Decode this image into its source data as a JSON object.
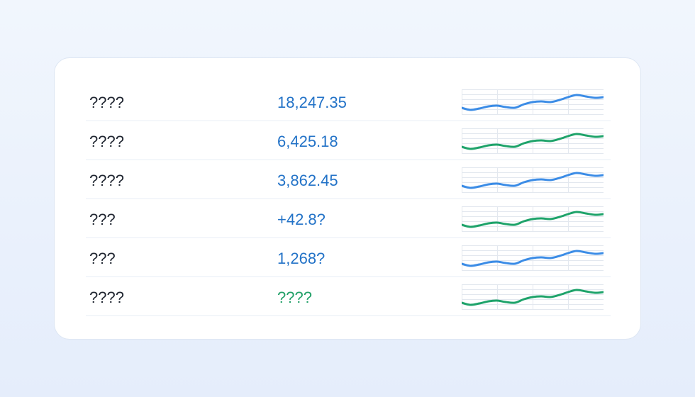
{
  "colors": {
    "blue": "#3b8ce6",
    "green": "#1ea36a",
    "value_blue": "#2272c7",
    "value_green": "#21a068",
    "grid": "#e3e8ef"
  },
  "rows": [
    {
      "label": "????",
      "value": "18,247.35",
      "value_tone": "blue",
      "spark_color": "blue"
    },
    {
      "label": "????",
      "value": "6,425.18",
      "value_tone": "blue",
      "spark_color": "green"
    },
    {
      "label": "????",
      "value": "3,862.45",
      "value_tone": "blue",
      "spark_color": "blue"
    },
    {
      "label": "???",
      "value": "+42.8?",
      "value_tone": "blue",
      "spark_color": "green"
    },
    {
      "label": "???",
      "value": "1,268?",
      "value_tone": "blue",
      "spark_color": "blue"
    },
    {
      "label": "????",
      "value": "????",
      "value_tone": "green",
      "spark_color": "green"
    }
  ]
}
